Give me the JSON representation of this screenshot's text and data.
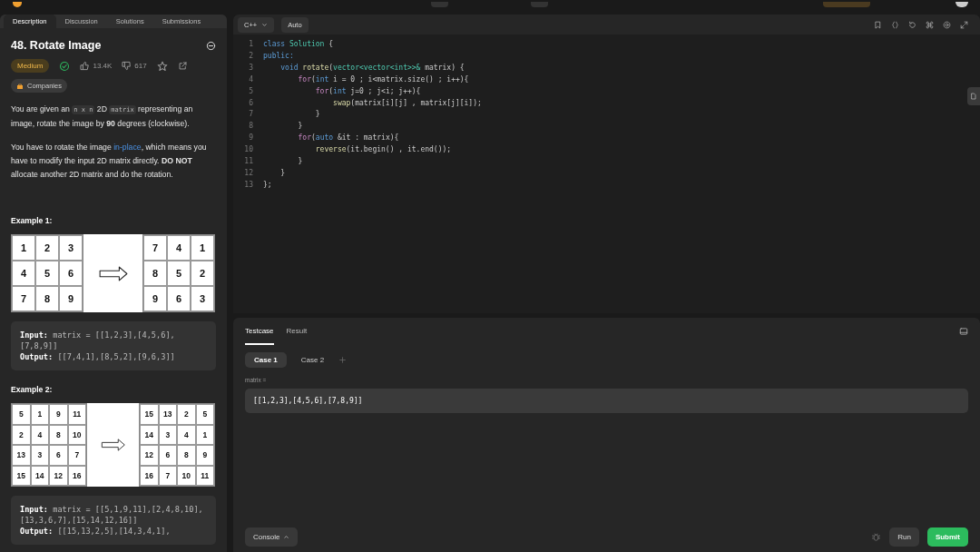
{
  "left_tabs": [
    {
      "label": "Description",
      "selected": true
    },
    {
      "label": "Discussion",
      "selected": false
    },
    {
      "label": "Solutions",
      "selected": false
    },
    {
      "label": "Submissions",
      "selected": false
    }
  ],
  "problem": {
    "title": "48. Rotate Image",
    "difficulty": "Medium",
    "solved": true,
    "likes": "13.4K",
    "dislikes": "617",
    "companies": "Companies",
    "paragraphs": [
      [
        {
          "text": "You are given an ",
          "kind": "plain"
        },
        {
          "text": "n x n",
          "kind": "code"
        },
        {
          "text": " 2D ",
          "kind": "plain"
        },
        {
          "text": "matrix",
          "kind": "code"
        },
        {
          "text": " representing an image, rotate the image by ",
          "kind": "plain"
        },
        {
          "text": "90",
          "kind": "bold"
        },
        {
          "text": " degrees (clockwise).",
          "kind": "plain"
        }
      ],
      [
        {
          "text": "You have to rotate the image ",
          "kind": "plain"
        },
        {
          "text": "in-place",
          "kind": "link"
        },
        {
          "text": ", which means you have to modify the input 2D matrix directly. ",
          "kind": "plain"
        },
        {
          "text": "DO NOT",
          "kind": "bold"
        },
        {
          "text": " allocate another 2D matrix and do the rotation.",
          "kind": "plain"
        }
      ]
    ],
    "examples": [
      {
        "heading": "Example 1:",
        "before": [
          [
            "1",
            "2",
            "3"
          ],
          [
            "4",
            "5",
            "6"
          ],
          [
            "7",
            "8",
            "9"
          ]
        ],
        "after": [
          [
            "7",
            "4",
            "1"
          ],
          [
            "8",
            "5",
            "2"
          ],
          [
            "9",
            "6",
            "3"
          ]
        ],
        "lines": [
          "**Input:** matrix = [[1,2,3],[4,5,6],[7,8,9]]",
          "**Output:** [[7,4,1],[8,5,2],[9,6,3]]"
        ]
      },
      {
        "heading": "Example 2:",
        "before": [
          [
            "5",
            "1",
            "9",
            "11"
          ],
          [
            "2",
            "4",
            "8",
            "10"
          ],
          [
            "13",
            "3",
            "6",
            "7"
          ],
          [
            "15",
            "14",
            "12",
            "16"
          ]
        ],
        "after": [
          [
            "15",
            "13",
            "2",
            "5"
          ],
          [
            "14",
            "3",
            "4",
            "1"
          ],
          [
            "12",
            "6",
            "8",
            "9"
          ],
          [
            "16",
            "7",
            "10",
            "11"
          ]
        ],
        "lines": [
          "**Input:** matrix = [[5,1,9,11],[2,4,8,10],[13,3,6,7],[15,14,12,16]]",
          "**Output:** [[15,13,2,5],[14,3,4,1],"
        ]
      }
    ]
  },
  "editor": {
    "language": "C++",
    "mode": "Auto",
    "lines": [
      {
        "number": "1",
        "tokens": [
          {
            "text": "class ",
            "kind": "keyword"
          },
          {
            "text": "Solution",
            "kind": "type"
          },
          {
            "text": " {",
            "kind": "plain"
          }
        ]
      },
      {
        "number": "2",
        "tokens": [
          {
            "text": "public:",
            "kind": "keyword"
          }
        ]
      },
      {
        "number": "3",
        "tokens": [
          {
            "text": "    void ",
            "kind": "keyword"
          },
          {
            "text": "rotate",
            "kind": "function"
          },
          {
            "text": "(",
            "kind": "plain"
          },
          {
            "text": "vector<vector<int>>&",
            "kind": "type"
          },
          {
            "text": " matrix) {",
            "kind": "plain"
          }
        ]
      },
      {
        "number": "4",
        "tokens": [
          {
            "text": "        for",
            "kind": "control"
          },
          {
            "text": "(",
            "kind": "plain"
          },
          {
            "text": "int",
            "kind": "keyword"
          },
          {
            "text": " i = 0 ; i<matrix.size() ; i++){",
            "kind": "plain"
          }
        ]
      },
      {
        "number": "5",
        "tokens": [
          {
            "text": "            for",
            "kind": "control"
          },
          {
            "text": "(",
            "kind": "plain"
          },
          {
            "text": "int",
            "kind": "keyword"
          },
          {
            "text": " j=0 ; j<i; j++){",
            "kind": "plain"
          }
        ]
      },
      {
        "number": "6",
        "tokens": [
          {
            "text": "                swap",
            "kind": "function"
          },
          {
            "text": "(matrix[i][j] , matrix[j][i]);",
            "kind": "plain"
          }
        ]
      },
      {
        "number": "7",
        "tokens": [
          {
            "text": "            }",
            "kind": "plain"
          }
        ]
      },
      {
        "number": "8",
        "tokens": [
          {
            "text": "        }",
            "kind": "plain"
          }
        ]
      },
      {
        "number": "9",
        "tokens": [
          {
            "text": "        for",
            "kind": "control"
          },
          {
            "text": "(",
            "kind": "plain"
          },
          {
            "text": "auto",
            "kind": "keyword"
          },
          {
            "text": " &it : matrix){",
            "kind": "plain"
          }
        ]
      },
      {
        "number": "10",
        "tokens": [
          {
            "text": "            reverse",
            "kind": "function"
          },
          {
            "text": "(it.begin() , it.end());",
            "kind": "plain"
          }
        ]
      },
      {
        "number": "11",
        "tokens": [
          {
            "text": "        }",
            "kind": "plain"
          }
        ]
      },
      {
        "number": "12",
        "tokens": [
          {
            "text": "    }",
            "kind": "plain"
          }
        ]
      },
      {
        "number": "13",
        "tokens": [
          {
            "text": "};",
            "kind": "plain"
          }
        ]
      }
    ]
  },
  "test_panel": {
    "tabs": [
      {
        "label": "Testcase",
        "selected": true
      },
      {
        "label": "Result",
        "selected": false
      }
    ],
    "cases": [
      {
        "label": "Case 1",
        "selected": true
      },
      {
        "label": "Case 2",
        "selected": false
      }
    ],
    "param_label": "matrix =",
    "value": "[[1,2,3],[4,5,6],[7,8,9]]"
  },
  "footer": {
    "console": "Console",
    "run": "Run",
    "submit": "Submit"
  }
}
